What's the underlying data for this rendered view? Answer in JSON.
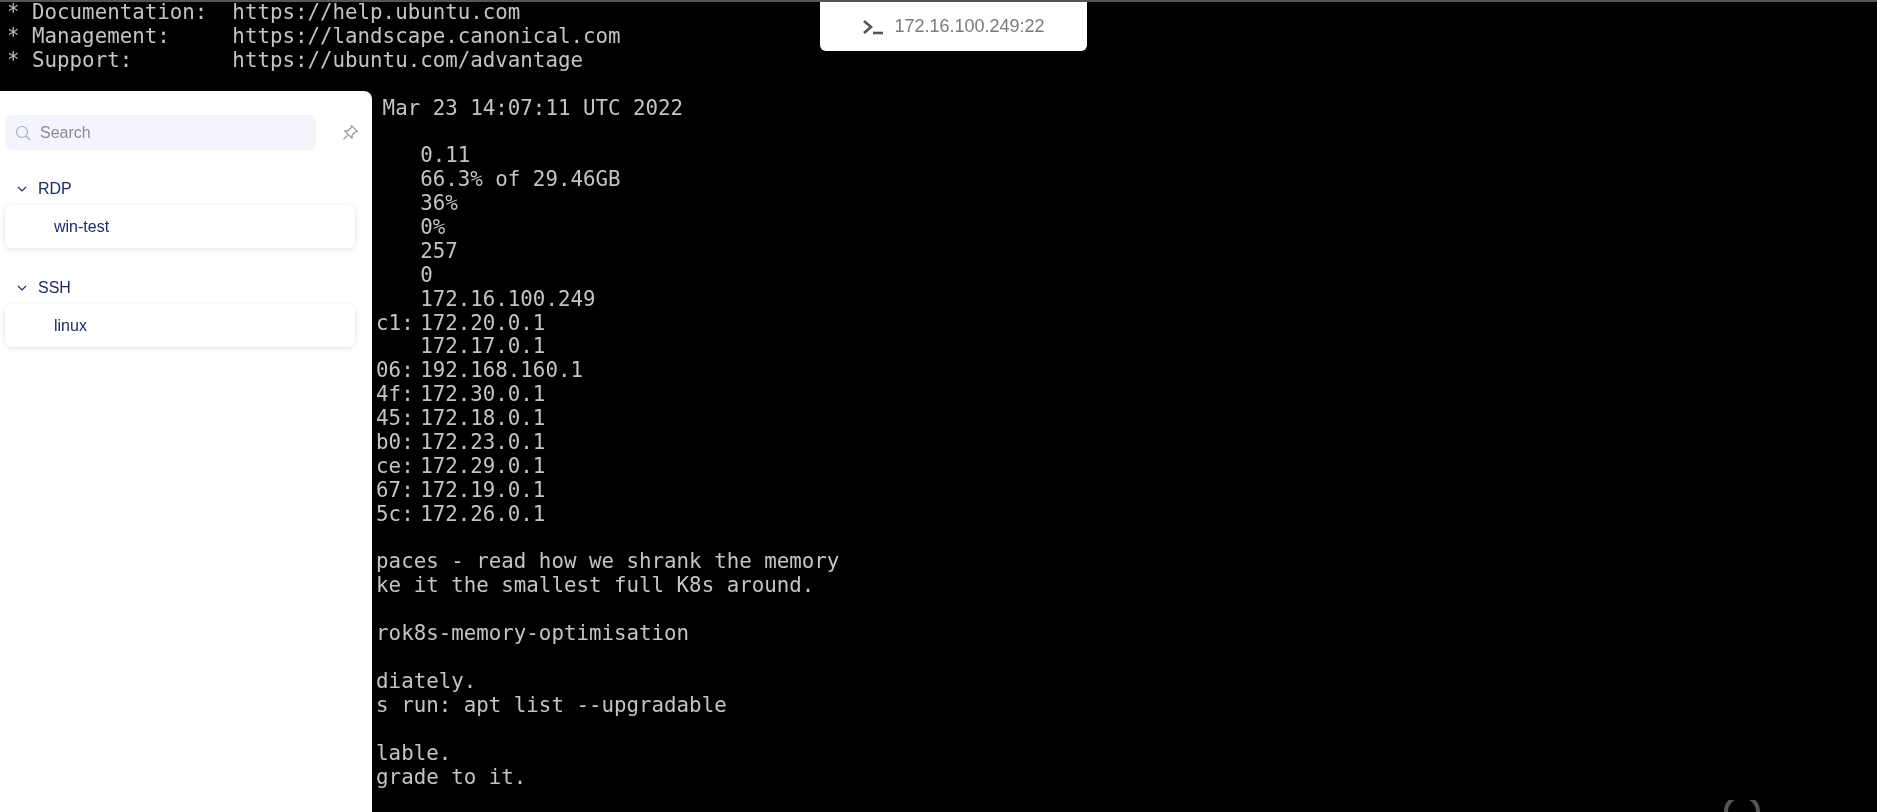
{
  "tab": {
    "title": "172.16.100.249:22"
  },
  "terminal": {
    "lines": [
      {
        "kind": "full",
        "text": "* Documentation:  https://help.ubuntu.com"
      },
      {
        "kind": "full",
        "text": "* Management:     https://landscape.canonical.com"
      },
      {
        "kind": "full",
        "text": "* Support:        https://ubuntu.com/advantage"
      },
      {
        "kind": "blank"
      },
      {
        "kind": "indented",
        "text": "Mar 23 14:07:11 UTC 2022"
      },
      {
        "kind": "blank"
      },
      {
        "kind": "pair",
        "value": "0.11"
      },
      {
        "kind": "pair",
        "value": "66.3% of 29.46GB"
      },
      {
        "kind": "pair",
        "value": "36%"
      },
      {
        "kind": "pair",
        "value": "0%"
      },
      {
        "kind": "pair",
        "value": "257"
      },
      {
        "kind": "pair",
        "value": "0"
      },
      {
        "kind": "pair",
        "value": "172.16.100.249"
      },
      {
        "kind": "pair",
        "label": "c1:",
        "value": "172.20.0.1"
      },
      {
        "kind": "pair",
        "value": "172.17.0.1"
      },
      {
        "kind": "pair",
        "label": "06:",
        "value": "192.168.160.1"
      },
      {
        "kind": "pair",
        "label": "4f:",
        "value": "172.30.0.1"
      },
      {
        "kind": "pair",
        "label": "45:",
        "value": "172.18.0.1"
      },
      {
        "kind": "pair",
        "label": "b0:",
        "value": "172.23.0.1"
      },
      {
        "kind": "pair",
        "label": "ce:",
        "value": "172.29.0.1"
      },
      {
        "kind": "pair",
        "label": "67:",
        "value": "172.19.0.1"
      },
      {
        "kind": "pair",
        "label": "5c:",
        "value": "172.26.0.1"
      },
      {
        "kind": "blank"
      },
      {
        "kind": "text",
        "text": "paces - read how we shrank the memory"
      },
      {
        "kind": "text",
        "text": "ke it the smallest full K8s around."
      },
      {
        "kind": "blank"
      },
      {
        "kind": "text",
        "text": "rok8s-memory-optimisation"
      },
      {
        "kind": "blank"
      },
      {
        "kind": "text",
        "text": "diately."
      },
      {
        "kind": "text",
        "text": "s run: apt list --upgradable"
      },
      {
        "kind": "blank"
      },
      {
        "kind": "text",
        "text": "lable."
      },
      {
        "kind": "text",
        "text": "grade to it."
      }
    ]
  },
  "sidebar": {
    "search": {
      "placeholder": "Search"
    },
    "groups": [
      {
        "name": "RDP",
        "expanded": true,
        "items": [
          {
            "label": "win-test"
          }
        ]
      },
      {
        "name": "SSH",
        "expanded": true,
        "items": [
          {
            "label": "linux"
          }
        ]
      }
    ]
  }
}
